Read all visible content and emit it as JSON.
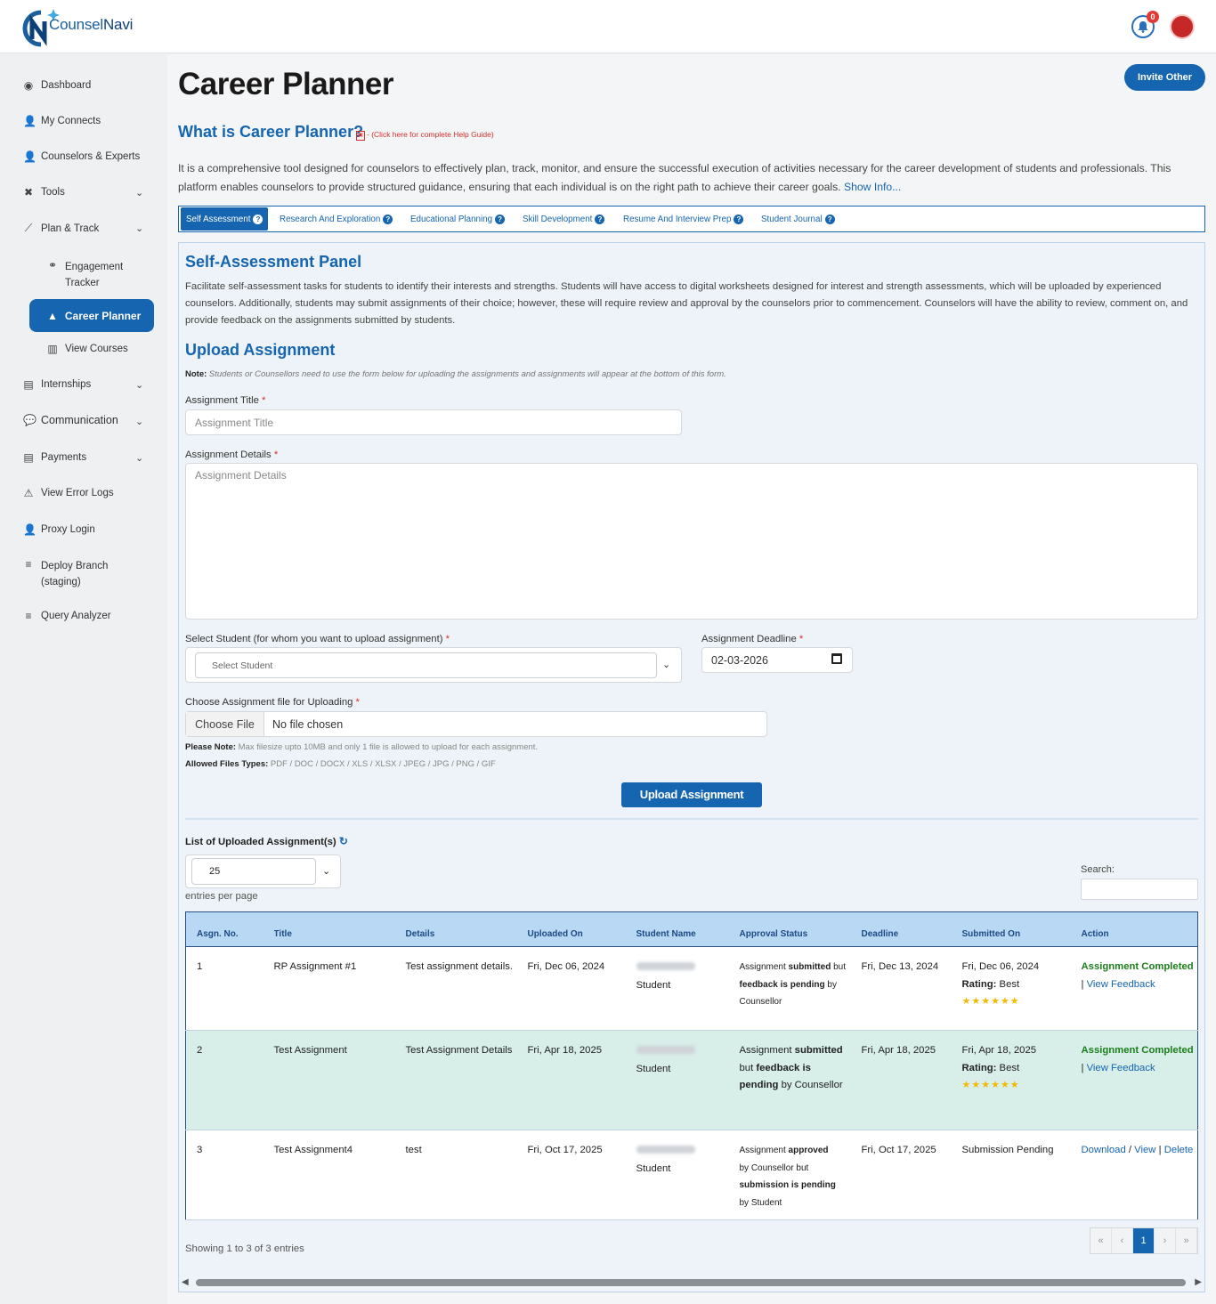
{
  "brand": {
    "name_part1": "Counsel",
    "name_part2": "Navi"
  },
  "header": {
    "notification_count": "0"
  },
  "sidebar": {
    "items": [
      {
        "label": "Dashboard",
        "icon": "dashboard-icon"
      },
      {
        "label": "My Connects",
        "icon": "user-icon"
      },
      {
        "label": "Counselors & Experts",
        "icon": "user-icon"
      },
      {
        "label": "Tools",
        "icon": "tools-icon"
      },
      {
        "label": "Plan & Track",
        "icon": "chart-icon"
      },
      {
        "label": "Engagement Tracker",
        "icon": "handshake-icon"
      },
      {
        "label": "Career Planner",
        "icon": "road-icon"
      },
      {
        "label": "View Courses",
        "icon": "books-icon"
      },
      {
        "label": "Internships",
        "icon": "briefcase-icon"
      },
      {
        "label": "Communication",
        "icon": "comments-icon"
      },
      {
        "label": "Payments",
        "icon": "briefcase-icon"
      },
      {
        "label": "View Error Logs",
        "icon": "warning-icon"
      },
      {
        "label": "Proxy Login",
        "icon": "user-icon"
      },
      {
        "label": "Deploy Branch (staging)",
        "icon": "database-icon"
      },
      {
        "label": "Query Analyzer",
        "icon": "database-icon"
      }
    ]
  },
  "page": {
    "title": "Career Planner",
    "invite_label": "Invite Other",
    "what_is": "What is Career Planner?",
    "help_link": "- (Click here for complete Help Guide)",
    "intro": "It is a comprehensive tool designed for counselors to effectively plan, track, monitor, and ensure the successful execution of activities necessary for the career development of students and professionals. This platform enables counselors to provide structured guidance, ensuring that each individual is on the right path to achieve their career goals.",
    "show_info": "Show Info..."
  },
  "tabs": [
    "Self Assessment",
    "Research And Exploration",
    "Educational Planning",
    "Skill Development",
    "Resume And Interview Prep",
    "Student Journal"
  ],
  "panel": {
    "title": "Self-Assessment Panel",
    "desc": "Facilitate self-assessment tasks for students to identify their interests and strengths. Students will have access to digital worksheets designed for interest and strength assessments, which will be uploaded by experienced counselors. Additionally, students may submit assignments of their choice; however, these will require review and approval by the counselors prior to commencement. Counselors will have the ability to review, comment on, and provide feedback on the assignments submitted by students.",
    "upload_title": "Upload Assignment",
    "note_label": "Note:",
    "note_text": "Students or Counsellors need to use the form below for uploading the assignments and assignments will appear at the bottom of this form."
  },
  "form": {
    "title_label": "Assignment Title",
    "title_placeholder": "Assignment Title",
    "details_label": "Assignment Details",
    "details_placeholder": "Assignment Details",
    "student_label": "Select Student (for whom you want to upload assignment)",
    "student_placeholder": "Select Student",
    "deadline_label": "Assignment Deadline",
    "deadline_value": "02-03-2026",
    "file_label": "Choose Assignment file for Uploading",
    "choose_file": "Choose File",
    "no_file": "No file chosen",
    "please_note_label": "Please Note:",
    "please_note_text": "Max filesize upto 10MB and only 1 file is allowed to upload for each assignment.",
    "allowed_label": "Allowed Files Types:",
    "allowed_text": "PDF / DOC / DOCX / XLS / XLSX / JPEG / JPG / PNG / GIF",
    "upload_button": "Upload Assignment"
  },
  "list": {
    "title": "List of Uploaded Assignment(s)",
    "entries_value": "25",
    "entries_label": "entries per page",
    "search_label": "Search:",
    "columns": [
      "Asgn. No.",
      "Title",
      "Details",
      "Uploaded On",
      "Student Name",
      "Approval Status",
      "Deadline",
      "Submitted On",
      "Action"
    ],
    "rows": [
      {
        "no": "1",
        "title": "RP Assignment #1",
        "details": "Test assignment details.",
        "uploaded": "Fri, Dec 06, 2024",
        "student": "Student",
        "status_a": "Assignment",
        "status_b": "submitted",
        "status_c": "but",
        "status_d": "feedback is pending",
        "status_e": "by Counsellor",
        "deadline": "Fri, Dec 13, 2024",
        "submitted": "Fri, Dec 06, 2024",
        "rating_label": "Rating:",
        "rating": "Best",
        "stars": "★★★★★★",
        "action_status": "Assignment Completed",
        "view": "View",
        "feedback": "Feedback"
      },
      {
        "no": "2",
        "title": "Test Assignment",
        "details": "Test Assignment Details",
        "uploaded": "Fri, Apr 18, 2025",
        "student": "Student",
        "status_a": "Assignment",
        "status_b": "submitted",
        "status_c": "but",
        "status_d": "feedback is pending",
        "status_e": "by Counsellor",
        "deadline": "Fri, Apr 18, 2025",
        "submitted": "Fri, Apr 18, 2025",
        "rating_label": "Rating:",
        "rating": "Best",
        "stars": "★★★★★★",
        "action_status": "Assignment Completed",
        "view": "View",
        "feedback": "Feedback"
      },
      {
        "no": "3",
        "title": "Test Assignment4",
        "details": "test",
        "uploaded": "Fri, Oct 17, 2025",
        "student": "Student",
        "status_a": "Assignment",
        "status_b": "approved",
        "status_c": "by Counsellor but",
        "status_d": "submission is pending",
        "status_e": "by Student",
        "deadline": "Fri, Oct 17, 2025",
        "submitted": "Submission Pending",
        "download": "Download",
        "view": "View",
        "delete": "Delete"
      }
    ],
    "showing": "Showing 1 to 3 of 3 entries",
    "pager": [
      "«",
      "‹",
      "1",
      "›",
      "»"
    ]
  }
}
